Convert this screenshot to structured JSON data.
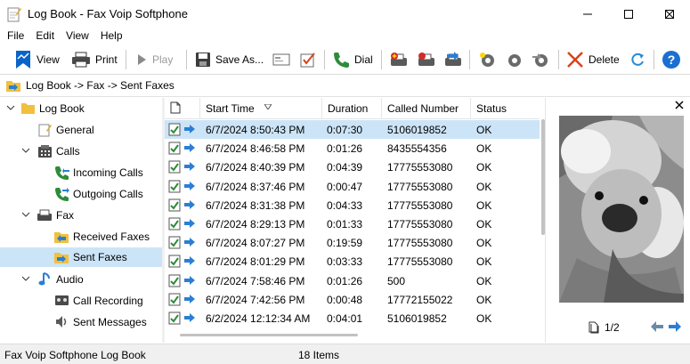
{
  "window": {
    "title": "Log Book - Fax Voip Softphone"
  },
  "menu": [
    "File",
    "Edit",
    "View",
    "Help"
  ],
  "toolbar": {
    "view": "View",
    "print": "Print",
    "play": "Play",
    "save_as": "Save As...",
    "dial": "Dial",
    "delete": "Delete"
  },
  "path": "Log Book -> Fax -> Sent Faxes",
  "tree": {
    "log_book": "Log Book",
    "general": "General",
    "calls": "Calls",
    "incoming_calls": "Incoming Calls",
    "outgoing_calls": "Outgoing Calls",
    "fax": "Fax",
    "received_faxes": "Received Faxes",
    "sent_faxes": "Sent Faxes",
    "audio": "Audio",
    "call_recording": "Call Recording",
    "sent_messages": "Sent Messages"
  },
  "list": {
    "headers": {
      "start_time": "Start Time",
      "duration": "Duration",
      "called_number": "Called Number",
      "status": "Status"
    },
    "rows": [
      {
        "start_time": "6/7/2024 8:50:43 PM",
        "duration": "0:07:30",
        "called_number": "5106019852",
        "status": "OK"
      },
      {
        "start_time": "6/7/2024 8:46:58 PM",
        "duration": "0:01:26",
        "called_number": "8435554356",
        "status": "OK"
      },
      {
        "start_time": "6/7/2024 8:40:39 PM",
        "duration": "0:04:39",
        "called_number": "17775553080",
        "status": "OK"
      },
      {
        "start_time": "6/7/2024 8:37:46 PM",
        "duration": "0:00:47",
        "called_number": "17775553080",
        "status": "OK"
      },
      {
        "start_time": "6/7/2024 8:31:38 PM",
        "duration": "0:04:33",
        "called_number": "17775553080",
        "status": "OK"
      },
      {
        "start_time": "6/7/2024 8:29:13 PM",
        "duration": "0:01:33",
        "called_number": "17775553080",
        "status": "OK"
      },
      {
        "start_time": "6/7/2024 8:07:27 PM",
        "duration": "0:19:59",
        "called_number": "17775553080",
        "status": "OK"
      },
      {
        "start_time": "6/7/2024 8:01:29 PM",
        "duration": "0:03:33",
        "called_number": "17775553080",
        "status": "OK"
      },
      {
        "start_time": "6/7/2024 7:58:46 PM",
        "duration": "0:01:26",
        "called_number": "500",
        "status": "OK"
      },
      {
        "start_time": "6/7/2024 7:42:56 PM",
        "duration": "0:00:48",
        "called_number": "17772155022",
        "status": "OK"
      },
      {
        "start_time": "6/2/2024 12:12:34 AM",
        "duration": "0:04:01",
        "called_number": "5106019852",
        "status": "OK"
      }
    ]
  },
  "preview": {
    "page_indicator": "1/2"
  },
  "status": {
    "left": "Fax Voip Softphone Log Book",
    "count": "18 Items"
  },
  "colors": {
    "accent": "#0a64c8",
    "selection": "#cce4f7",
    "ok_green": "#2e8b3a"
  }
}
